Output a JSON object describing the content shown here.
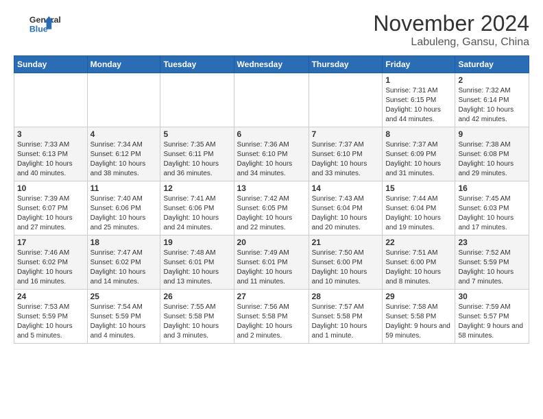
{
  "header": {
    "logo_line1": "General",
    "logo_line2": "Blue",
    "month": "November 2024",
    "location": "Labuleng, Gansu, China"
  },
  "weekdays": [
    "Sunday",
    "Monday",
    "Tuesday",
    "Wednesday",
    "Thursday",
    "Friday",
    "Saturday"
  ],
  "weeks": [
    [
      {
        "day": "",
        "info": ""
      },
      {
        "day": "",
        "info": ""
      },
      {
        "day": "",
        "info": ""
      },
      {
        "day": "",
        "info": ""
      },
      {
        "day": "",
        "info": ""
      },
      {
        "day": "1",
        "info": "Sunrise: 7:31 AM\nSunset: 6:15 PM\nDaylight: 10 hours and 44 minutes."
      },
      {
        "day": "2",
        "info": "Sunrise: 7:32 AM\nSunset: 6:14 PM\nDaylight: 10 hours and 42 minutes."
      }
    ],
    [
      {
        "day": "3",
        "info": "Sunrise: 7:33 AM\nSunset: 6:13 PM\nDaylight: 10 hours and 40 minutes."
      },
      {
        "day": "4",
        "info": "Sunrise: 7:34 AM\nSunset: 6:12 PM\nDaylight: 10 hours and 38 minutes."
      },
      {
        "day": "5",
        "info": "Sunrise: 7:35 AM\nSunset: 6:11 PM\nDaylight: 10 hours and 36 minutes."
      },
      {
        "day": "6",
        "info": "Sunrise: 7:36 AM\nSunset: 6:10 PM\nDaylight: 10 hours and 34 minutes."
      },
      {
        "day": "7",
        "info": "Sunrise: 7:37 AM\nSunset: 6:10 PM\nDaylight: 10 hours and 33 minutes."
      },
      {
        "day": "8",
        "info": "Sunrise: 7:37 AM\nSunset: 6:09 PM\nDaylight: 10 hours and 31 minutes."
      },
      {
        "day": "9",
        "info": "Sunrise: 7:38 AM\nSunset: 6:08 PM\nDaylight: 10 hours and 29 minutes."
      }
    ],
    [
      {
        "day": "10",
        "info": "Sunrise: 7:39 AM\nSunset: 6:07 PM\nDaylight: 10 hours and 27 minutes."
      },
      {
        "day": "11",
        "info": "Sunrise: 7:40 AM\nSunset: 6:06 PM\nDaylight: 10 hours and 25 minutes."
      },
      {
        "day": "12",
        "info": "Sunrise: 7:41 AM\nSunset: 6:06 PM\nDaylight: 10 hours and 24 minutes."
      },
      {
        "day": "13",
        "info": "Sunrise: 7:42 AM\nSunset: 6:05 PM\nDaylight: 10 hours and 22 minutes."
      },
      {
        "day": "14",
        "info": "Sunrise: 7:43 AM\nSunset: 6:04 PM\nDaylight: 10 hours and 20 minutes."
      },
      {
        "day": "15",
        "info": "Sunrise: 7:44 AM\nSunset: 6:04 PM\nDaylight: 10 hours and 19 minutes."
      },
      {
        "day": "16",
        "info": "Sunrise: 7:45 AM\nSunset: 6:03 PM\nDaylight: 10 hours and 17 minutes."
      }
    ],
    [
      {
        "day": "17",
        "info": "Sunrise: 7:46 AM\nSunset: 6:02 PM\nDaylight: 10 hours and 16 minutes."
      },
      {
        "day": "18",
        "info": "Sunrise: 7:47 AM\nSunset: 6:02 PM\nDaylight: 10 hours and 14 minutes."
      },
      {
        "day": "19",
        "info": "Sunrise: 7:48 AM\nSunset: 6:01 PM\nDaylight: 10 hours and 13 minutes."
      },
      {
        "day": "20",
        "info": "Sunrise: 7:49 AM\nSunset: 6:01 PM\nDaylight: 10 hours and 11 minutes."
      },
      {
        "day": "21",
        "info": "Sunrise: 7:50 AM\nSunset: 6:00 PM\nDaylight: 10 hours and 10 minutes."
      },
      {
        "day": "22",
        "info": "Sunrise: 7:51 AM\nSunset: 6:00 PM\nDaylight: 10 hours and 8 minutes."
      },
      {
        "day": "23",
        "info": "Sunrise: 7:52 AM\nSunset: 5:59 PM\nDaylight: 10 hours and 7 minutes."
      }
    ],
    [
      {
        "day": "24",
        "info": "Sunrise: 7:53 AM\nSunset: 5:59 PM\nDaylight: 10 hours and 5 minutes."
      },
      {
        "day": "25",
        "info": "Sunrise: 7:54 AM\nSunset: 5:59 PM\nDaylight: 10 hours and 4 minutes."
      },
      {
        "day": "26",
        "info": "Sunrise: 7:55 AM\nSunset: 5:58 PM\nDaylight: 10 hours and 3 minutes."
      },
      {
        "day": "27",
        "info": "Sunrise: 7:56 AM\nSunset: 5:58 PM\nDaylight: 10 hours and 2 minutes."
      },
      {
        "day": "28",
        "info": "Sunrise: 7:57 AM\nSunset: 5:58 PM\nDaylight: 10 hours and 1 minute."
      },
      {
        "day": "29",
        "info": "Sunrise: 7:58 AM\nSunset: 5:58 PM\nDaylight: 9 hours and 59 minutes."
      },
      {
        "day": "30",
        "info": "Sunrise: 7:59 AM\nSunset: 5:57 PM\nDaylight: 9 hours and 58 minutes."
      }
    ]
  ]
}
